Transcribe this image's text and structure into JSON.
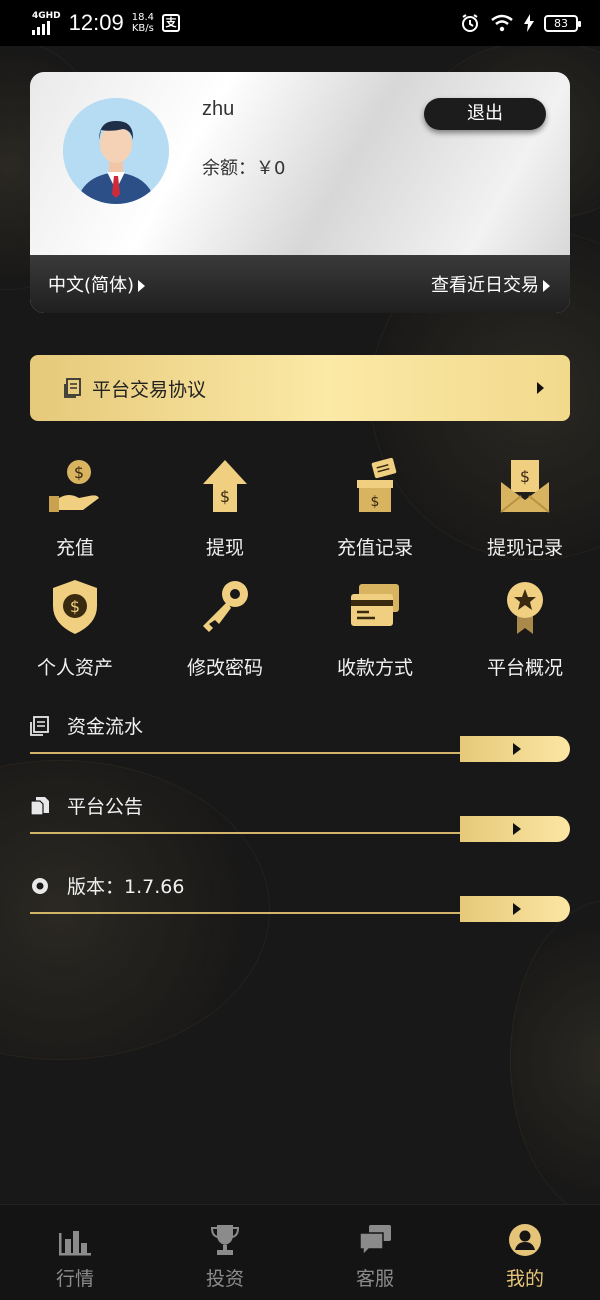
{
  "status_bar": {
    "network": "4GHD",
    "time": "12:09",
    "speed_value": "18.4",
    "speed_unit": "KB/s",
    "app_badge": "支",
    "battery": "83"
  },
  "user_card": {
    "username": "zhu",
    "balance": "余额：￥0",
    "logout_label": "退出",
    "language": "中文(简体)",
    "recent_transactions": "查看近日交易"
  },
  "agreement": {
    "label": "平台交易协议"
  },
  "grid": [
    {
      "label": "充值",
      "icon": "recharge-icon"
    },
    {
      "label": "提现",
      "icon": "withdraw-icon"
    },
    {
      "label": "充值记录",
      "icon": "recharge-record-icon"
    },
    {
      "label": "提现记录",
      "icon": "withdraw-record-icon"
    },
    {
      "label": "个人资产",
      "icon": "assets-shield-icon"
    },
    {
      "label": "修改密码",
      "icon": "key-icon"
    },
    {
      "label": "收款方式",
      "icon": "card-icon"
    },
    {
      "label": "平台概况",
      "icon": "badge-icon"
    }
  ],
  "list": [
    {
      "label": "资金流水",
      "icon": "ledger-icon"
    },
    {
      "label": "平台公告",
      "icon": "notice-icon"
    },
    {
      "label": "版本：1.7.66",
      "icon": "version-icon"
    }
  ],
  "tabbar": [
    {
      "label": "行情",
      "icon": "market-chart-icon",
      "active": false
    },
    {
      "label": "投资",
      "icon": "trophy-icon",
      "active": false
    },
    {
      "label": "客服",
      "icon": "chat-icon",
      "active": false
    },
    {
      "label": "我的",
      "icon": "user-icon",
      "active": true
    }
  ],
  "colors": {
    "gold": "#e5c47a",
    "background": "#181818",
    "inactive_tab": "#8b8b8b"
  }
}
